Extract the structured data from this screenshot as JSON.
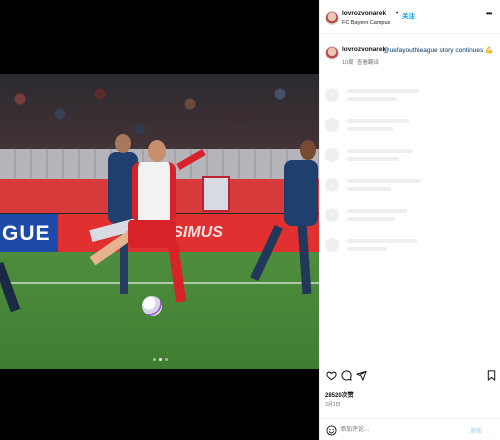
{
  "post": {
    "username": "lovrozvonarek",
    "separator": "•",
    "follow_label": "关注",
    "location": "FC Bayern Campus",
    "more_label": "•••",
    "caption": {
      "username": "lovrozvonarek",
      "text": "@uefayouthleague story continues 💪",
      "time": "10周",
      "translate_label": "查看翻译"
    },
    "likes": "28520次赞",
    "date": "3月1日",
    "comment": {
      "placeholder": "添加评论...",
      "post_label": "发布"
    },
    "media": {
      "ad_text_left": "GUE",
      "ad_text_right": "ASSIMUS",
      "carousel_count": 3,
      "carousel_active": 1
    }
  },
  "icons": {
    "like": "heart-icon",
    "comment": "comment-icon",
    "share": "share-icon",
    "save": "bookmark-icon",
    "emoji": "emoji-icon"
  },
  "colors": {
    "follow": "#0095f6",
    "link": "#00376b",
    "muted": "#737373",
    "skeleton": "#efefef"
  }
}
